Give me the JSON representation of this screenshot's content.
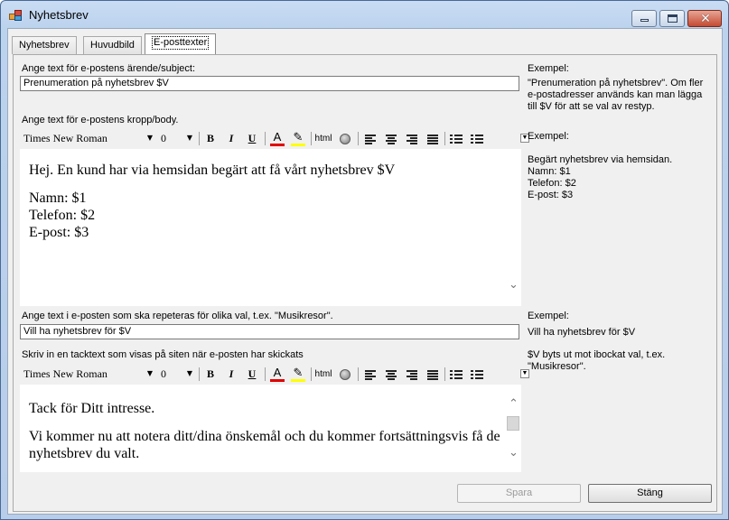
{
  "window": {
    "title": "Nyhetsbrev"
  },
  "tabs": [
    {
      "label": "Nyhetsbrev"
    },
    {
      "label": "Huvudbild"
    },
    {
      "label": "E-posttexter"
    }
  ],
  "subject": {
    "label": "Ange text för e-postens ärende/subject:",
    "value": "Prenumeration på nyhetsbrev $V",
    "example_title": "Exempel:",
    "example_text": "\"Prenumeration på nyhetsbrev\". Om fler e-postadresser används kan man lägga till $V för att se val av restyp."
  },
  "body": {
    "label": "Ange text för e-postens kropp/body.",
    "font_name": "Times New Roman",
    "font_size": "0",
    "lines": [
      "Hej. En kund har via hemsidan begärt att få vårt nyhetsbrev $V",
      "",
      "Namn: $1",
      "Telefon: $2",
      "E-post: $3"
    ],
    "example_title": "Exempel:",
    "example_lines": [
      "Begärt nyhetsbrev via hemsidan.",
      "Namn: $1",
      "Telefon: $2",
      "E-post: $3"
    ]
  },
  "repeat": {
    "label": "Ange text i e-posten som ska repeteras för olika val, t.ex. \"Musikresor\".",
    "value": "Vill ha nyhetsbrev för $V",
    "example_title": "Exempel:",
    "example_text": "Vill ha nyhetsbrev för $V"
  },
  "thanks": {
    "label": "Skriv in en tacktext som visas på siten när e-posten har skickats",
    "font_name": "Times New Roman",
    "font_size": "0",
    "lines": [
      "Tack för Ditt intresse.",
      "",
      "Vi kommer nu att notera ditt/dina önskemål och du kommer fortsättningsvis få de",
      "nyhetsbrev du valt."
    ],
    "note": "$V byts ut mot ibockat val, t.ex. \"Musikresor\"."
  },
  "toolbar": {
    "bold": "B",
    "italic": "I",
    "underline": "U",
    "html": "html"
  },
  "buttons": {
    "save": "Spara",
    "close": "Stäng"
  },
  "icons": [
    "app-icon",
    "minimize-icon",
    "maximize-icon",
    "close-icon",
    "font-color-icon",
    "highlight-icon",
    "globe-icon",
    "align-left-icon",
    "align-center-icon",
    "align-right-icon",
    "justify-icon",
    "numbered-list-icon",
    "bullet-list-icon",
    "chevron-down-icon",
    "scroll-up-icon",
    "scroll-down-icon"
  ],
  "colors": {
    "font_color_bar": "#e00000",
    "highlight_bar": "#ffff00",
    "titlebar": "#bcd3ee"
  }
}
